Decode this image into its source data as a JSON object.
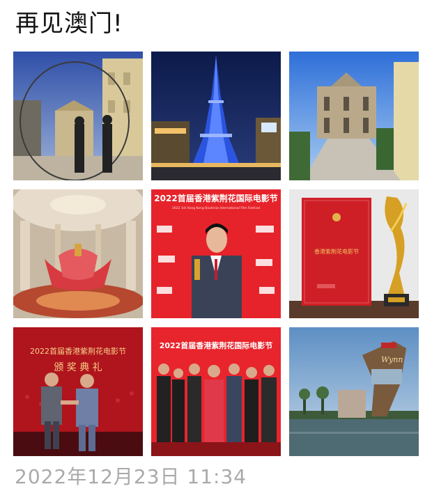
{
  "post": {
    "text": "再见澳门!",
    "timestamp": "2022年12月23日 11:34"
  },
  "photos": [
    {
      "name": "photo-silhouette-arch"
    },
    {
      "name": "photo-eiffel-tower-night"
    },
    {
      "name": "photo-ruins-st-paul"
    },
    {
      "name": "photo-lotus-sculpture"
    },
    {
      "name": "photo-award-man-red-backdrop"
    },
    {
      "name": "photo-certificate-trophy"
    },
    {
      "name": "photo-award-handshake-stage"
    },
    {
      "name": "photo-award-group"
    },
    {
      "name": "photo-wynn-lake"
    }
  ],
  "banner_text": {
    "award_banner": "2022首届香港紫荆花国际电影节",
    "award_banner_sub": "2022 1st Hong Kong Bauhinia International Film Festival",
    "stage_banner": "2022首届香港紫荆花电影节",
    "stage_caption": "颁 奖 典 礼",
    "certificate_text": "香港紫荆花电影节",
    "wynn_sign": "Wynn"
  }
}
